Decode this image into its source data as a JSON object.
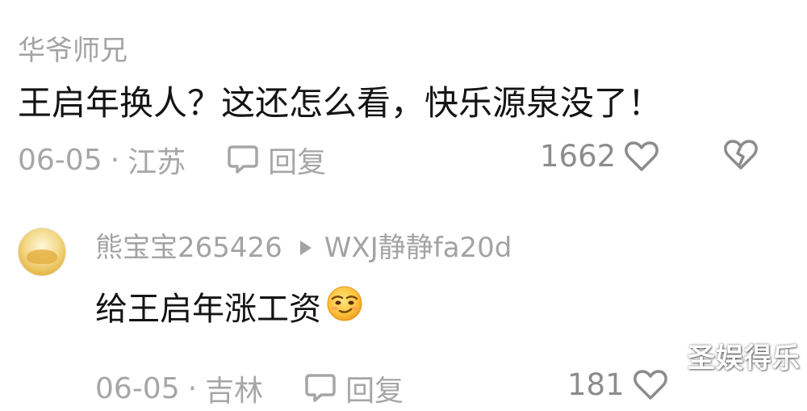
{
  "comment": {
    "username": "华爷师兄",
    "content": "王启年换人？这还怎么看，快乐源泉没了！",
    "date": "06-05",
    "location": "江苏",
    "reply_label": "回复",
    "like_count": "1662"
  },
  "reply": {
    "username": "熊宝宝265426",
    "reply_to": "WXJ静静fa20d",
    "content": "给王启年涨工资",
    "date": "06-05",
    "location": "吉林",
    "reply_label": "回复",
    "like_count": "181"
  },
  "separator": "·",
  "watermark": "圣娱得乐",
  "icons": {
    "reply": "chat-bubble-icon",
    "like": "heart-outline-icon",
    "dislike": "broken-heart-icon",
    "emoji": "smirk-emoji-icon",
    "reply_arrow": "play-triangle-icon"
  },
  "colors": {
    "primary_text": "#141414",
    "secondary_text": "#a3a3a3",
    "icon_gray": "#8c8c8c"
  }
}
